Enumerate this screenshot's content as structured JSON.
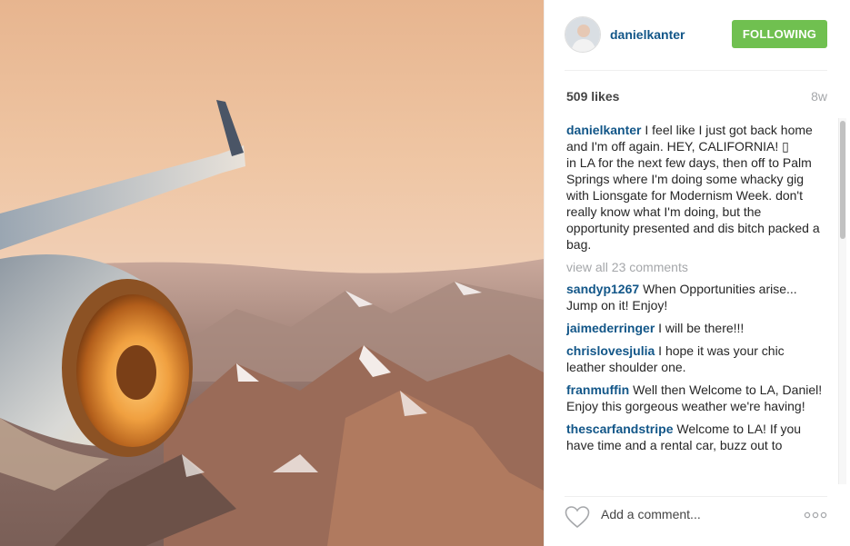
{
  "post": {
    "username": "danielkanter",
    "follow_label": "FOLLOWING",
    "likes": "509 likes",
    "age": "8w",
    "caption_user": "danielkanter",
    "caption_line1": "I feel like I just got back home and I'm off again. HEY, CALIFORNIA! ▯",
    "caption_line2": "in LA for the next few days, then off to Palm Springs where I'm doing some whacky gig with Lionsgate for Modernism Week. don't really know what I'm doing, but the opportunity presented and dis bitch packed a bag.",
    "view_all": "view all 23 comments",
    "comments": [
      {
        "user": "sandyp1267",
        "text": "When Opportunities arise... Jump on it! Enjoy!"
      },
      {
        "user": "jaimederringer",
        "text": "I will be there!!!"
      },
      {
        "user": "chrislovesjulia",
        "text": "I hope it was your chic leather shoulder one."
      },
      {
        "user": "franmuffin",
        "text": "Well then Welcome to LA, Daniel! Enjoy this gorgeous weather we're having!"
      },
      {
        "user": "thescarfandstripe",
        "text": "Welcome to LA! If you have time and a rental car, buzz out to"
      }
    ],
    "add_comment_placeholder": "Add a comment...",
    "colors": {
      "username": "#125688",
      "follow_button": "#70c050",
      "muted": "#a5a7aa"
    },
    "icons": {
      "like": "heart-outline-icon",
      "more": "more-options-icon"
    }
  }
}
